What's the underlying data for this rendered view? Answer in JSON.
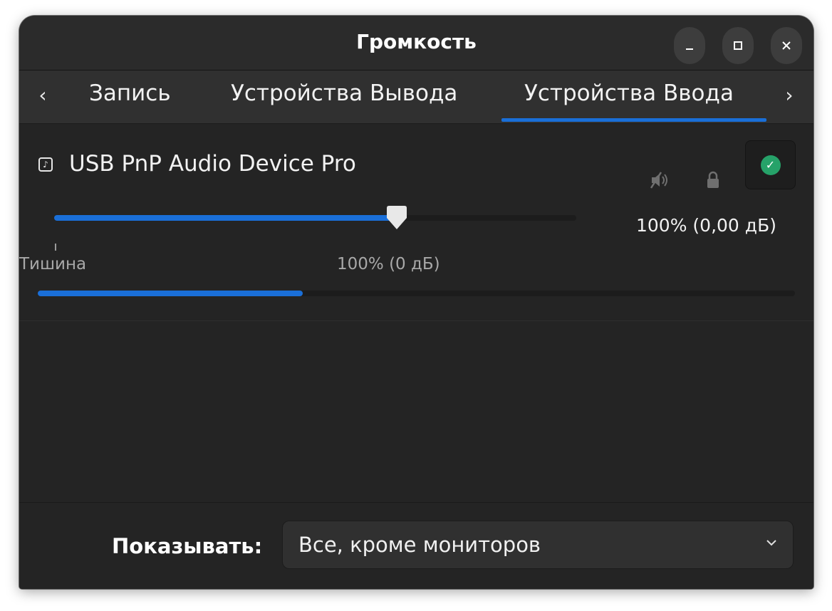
{
  "window": {
    "title": "Громкость",
    "minimize_icon": "minimize-icon",
    "maximize_icon": "maximize-icon",
    "close_icon": "close-icon"
  },
  "tabs": {
    "prev_arrow": "‹",
    "next_arrow": "›",
    "items": [
      {
        "label": "Запись",
        "active": false
      },
      {
        "label": "Устройства Вывода",
        "active": false
      },
      {
        "label": "Устройства Ввода",
        "active": true
      }
    ],
    "accent_color": "#1a6fd8"
  },
  "device": {
    "icon": "music-note-icon",
    "name": "USB PnP Audio Device Pro",
    "mute_icon": "speaker-muted-icon",
    "lock_icon": "lock-icon",
    "default_icon": "check-circle-icon",
    "default_color": "#26a269",
    "volume_readout": "100% (0,00 дБ)",
    "slider": {
      "value_percent": 65.6,
      "tick_silence_label": "Тишина",
      "tick_100_label": "100% (0 дБ)"
    },
    "level_meter_fraction": 0.35
  },
  "footer": {
    "show_label": "Показывать:",
    "show_value": "Все, кроме мониторов",
    "dropdown_icon": "chevron-down-icon"
  }
}
